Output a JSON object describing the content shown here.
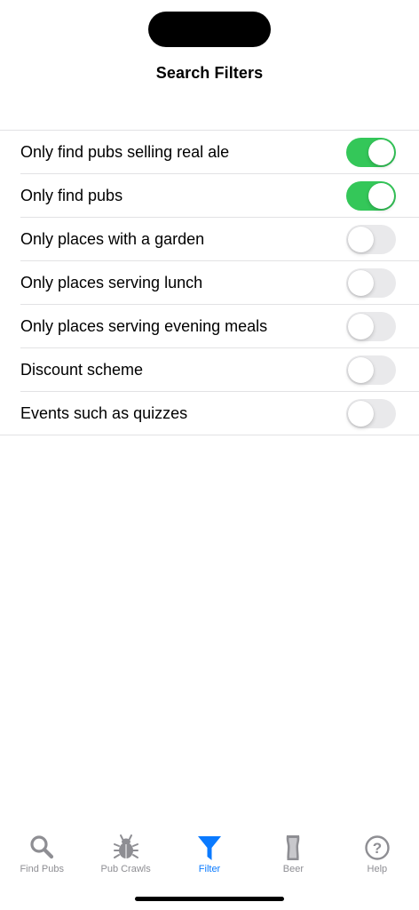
{
  "header": {
    "title": "Search Filters"
  },
  "filters": [
    {
      "label": "Only find pubs selling real ale",
      "on": true
    },
    {
      "label": "Only find pubs",
      "on": true
    },
    {
      "label": "Only places with a garden",
      "on": false
    },
    {
      "label": "Only places serving lunch",
      "on": false
    },
    {
      "label": "Only places serving evening meals",
      "on": false
    },
    {
      "label": "Discount scheme",
      "on": false
    },
    {
      "label": "Events such as quizzes",
      "on": false
    }
  ],
  "tabbar": {
    "tabs": [
      {
        "label": "Find Pubs",
        "icon": "magnifier-icon",
        "active": false
      },
      {
        "label": "Pub Crawls",
        "icon": "bug-icon",
        "active": false
      },
      {
        "label": "Filter",
        "icon": "funnel-icon",
        "active": true
      },
      {
        "label": "Beer",
        "icon": "pint-glass-icon",
        "active": false
      },
      {
        "label": "Help",
        "icon": "question-circle-icon",
        "active": false
      }
    ]
  },
  "colors": {
    "toggle_on": "#34c759",
    "toggle_off": "#e9e9eb",
    "accent": "#0a7aff",
    "tab_inactive": "#8e8e93"
  }
}
